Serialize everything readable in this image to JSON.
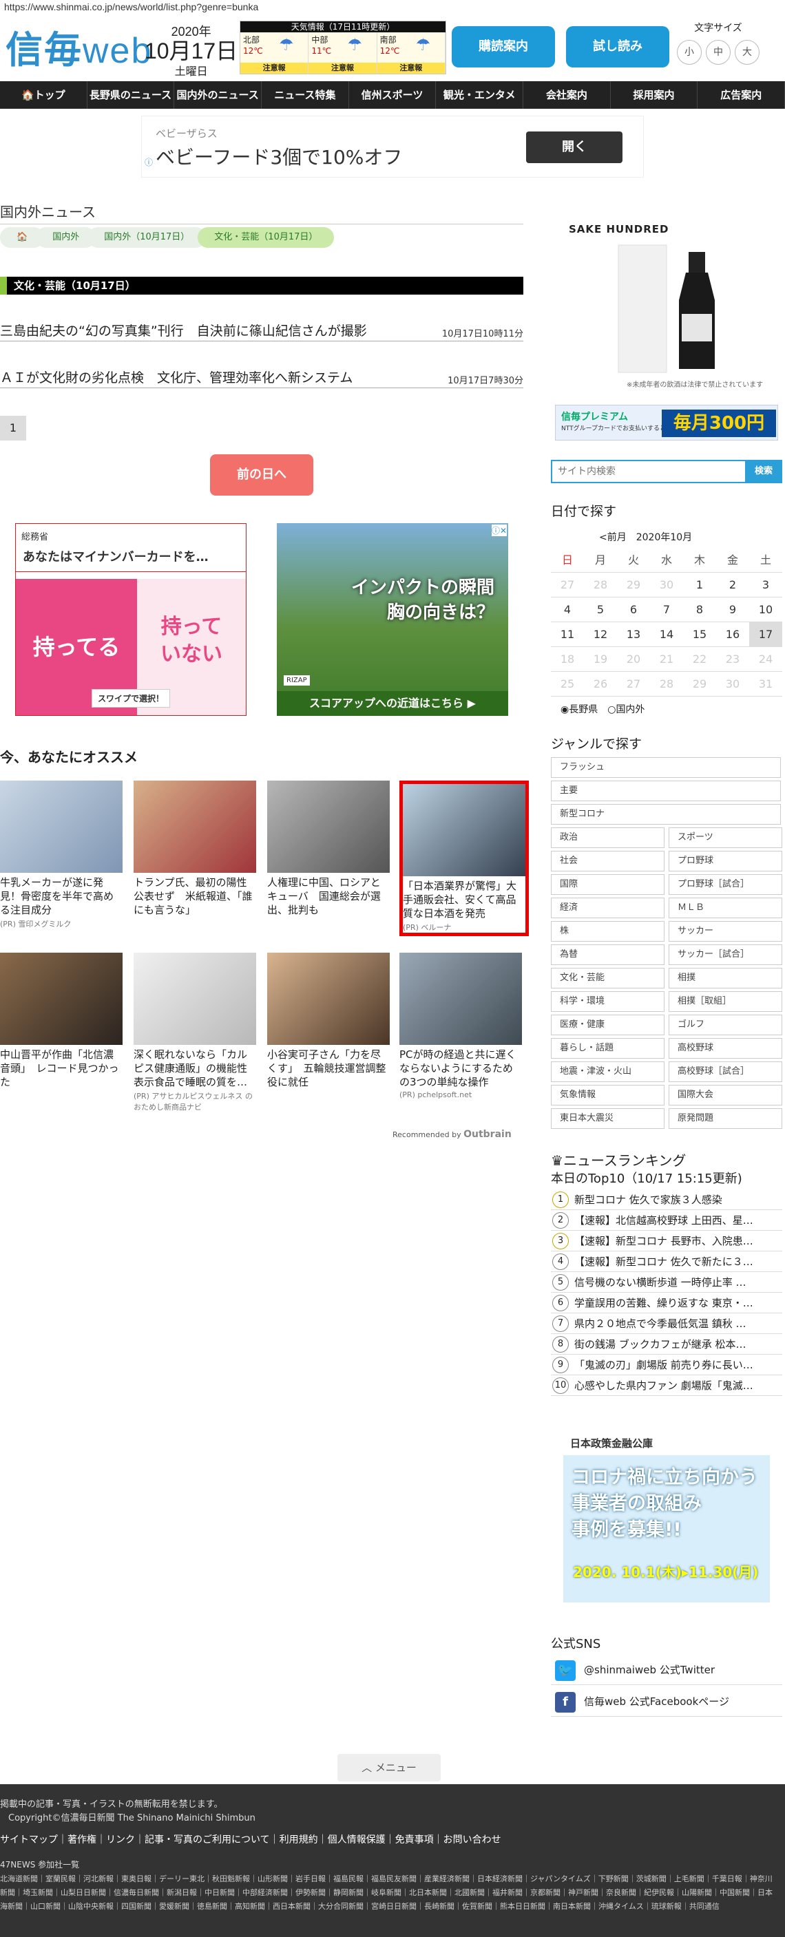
{
  "browser": {
    "url": "https://www.shinmai.co.jp/news/world/list.php?genre=bunka"
  },
  "header": {
    "logo_kanji": "信毎",
    "logo_web": "web",
    "year": "2020年",
    "month_day": "10月17日",
    "weekday": "土曜日",
    "weather_title": "天気情報（17日11時更新）",
    "regions": [
      {
        "name": "北部",
        "temp": "12℃",
        "warning": "注意報"
      },
      {
        "name": "中部",
        "temp": "11℃",
        "warning": "注意報"
      },
      {
        "name": "南部",
        "temp": "12℃",
        "warning": "注意報"
      }
    ],
    "subscribe_btn": "購読案内",
    "trial_btn": "試し読み",
    "font_size_label": "文字サイズ",
    "font_sizes": [
      "小",
      "中",
      "大"
    ]
  },
  "nav": [
    "🏠トップ",
    "長野県のニュース",
    "国内外のニュース",
    "ニュース特集",
    "信州スポーツ",
    "観光・エンタメ",
    "会社案内",
    "採用案内",
    "広告案内"
  ],
  "ad_top": {
    "sub": "ベビーザらス",
    "title": "ベビーフード3個で10%オフ",
    "button": "開く",
    "info": "ⓘ"
  },
  "section": {
    "title": "国内外ニュース",
    "breadcrumb": [
      "🏠",
      "国内外",
      "国内外（10月17日）",
      "文化・芸能（10月17日）"
    ],
    "category": "文化・芸能（10月17日）"
  },
  "articles": [
    {
      "title": "三島由紀夫の“幻の写真集”刊行　自決前に篠山紀信さんが撮影",
      "time": "10月17日10時11分"
    },
    {
      "title": "ＡＩが文化財の劣化点検　文化庁、管理効率化へ新システム",
      "time": "10月17日7時30分"
    }
  ],
  "pagination": {
    "page": "1",
    "prev_day": "前の日へ"
  },
  "ad_left": {
    "org": "総務省",
    "title": "あなたはマイナンバーカードを…",
    "left": "持ってる",
    "right": "持って\nいない",
    "swipe": "スワイプで選択！"
  },
  "ad_right": {
    "headline1": "インパクトの瞬間",
    "headline2": "胸の向きは？",
    "brand": "RIZAP",
    "footer": "スコアアップへの近道はこちら ▶"
  },
  "recommend": {
    "title": "今、あなたにオススメ",
    "cards": [
      {
        "title": "牛乳メーカーが遂に発見！骨密度を半年で高める注目成分",
        "pr": "(PR) 雪印メグミルク"
      },
      {
        "title": "トランプ氏、最初の陽性公表せず　米紙報道、「誰にも言うな」",
        "pr": ""
      },
      {
        "title": "人権理に中国、ロシアとキューバ　国連総会が選出、批判も",
        "pr": ""
      },
      {
        "title": "「日本酒業界が驚愕」大手通販会社、安くて高品質な日本酒を発売",
        "pr": "(PR) ベルーナ"
      },
      {
        "title": "中山晋平が作曲「北信濃音頭」　レコード見つかった",
        "pr": ""
      },
      {
        "title": "深く眠れないなら「カルピス健康通販」の機能性表示食品で睡眠の質を…",
        "pr": "(PR) アサヒカルピスウェルネス の おためし新商品ナビ"
      },
      {
        "title": "小谷実可子さん「力を尽くす」　五輪競技運営調整役に就任",
        "pr": ""
      },
      {
        "title": "PCが時の経過と共に遅くならないようにするための3つの単純な操作",
        "pr": "(PR) pchelpsoft.net"
      }
    ],
    "recommended_by": "Recommended by",
    "outbrain": "Outbrain"
  },
  "sidebar": {
    "sake_title": "SAKE HUNDRED",
    "sake_note": "※未成年者の飲酒は法律で禁止されています",
    "premium_a": "信毎プレミアム",
    "premium_b": "NTTグループカードでお支払いすると",
    "premium_c": "毎月300円",
    "search_placeholder": "サイト内検索",
    "search_btn": "検索",
    "date_title": "日付で探す",
    "cal_prev": "<前月",
    "cal_month": "2020年10月",
    "cal_head": [
      "日",
      "月",
      "火",
      "水",
      "木",
      "金",
      "土"
    ],
    "cal_rows": [
      [
        "27",
        "28",
        "29",
        "30",
        "1",
        "2",
        "3"
      ],
      [
        "4",
        "5",
        "6",
        "7",
        "8",
        "9",
        "10"
      ],
      [
        "11",
        "12",
        "13",
        "14",
        "15",
        "16",
        "17"
      ],
      [
        "18",
        "19",
        "20",
        "21",
        "22",
        "23",
        "24"
      ],
      [
        "25",
        "26",
        "27",
        "28",
        "29",
        "30",
        "31"
      ]
    ],
    "radio1": "長野県",
    "radio2": "国内外",
    "genre_title": "ジャンルで探す",
    "genre_full": [
      "フラッシュ",
      "主要",
      "新型コロナ"
    ],
    "genre_grid": [
      "政治",
      "スポーツ",
      "社会",
      "プロ野球",
      "国際",
      "プロ野球［試合］",
      "経済",
      "ＭＬＢ",
      "株",
      "サッカー",
      "為替",
      "サッカー［試合］",
      "文化・芸能",
      "相撲",
      "科学・環境",
      "相撲［取組］",
      "医療・健康",
      "ゴルフ",
      "暮らし・話題",
      "高校野球",
      "地震・津波・火山",
      "高校野球［試合］",
      "気象情報",
      "国際大会",
      "東日本大震災",
      "原発問題"
    ],
    "ranking_title": "ニュースランキング",
    "ranking_sub": "本日のTop10（10/17 15:15更新)",
    "ranking": [
      "新型コロナ 佐久で家族３人感染",
      "【速報】北信越高校野球 上田西、星…",
      "【速報】新型コロナ 長野市、入院患…",
      "【速報】新型コロナ 佐久で新たに３…",
      "信号機のない横断歩道 一時停止率 …",
      "学童誤用の苦難、繰り返すな 東京・…",
      "県内２０地点で今季最低気温 鎮秋 …",
      "街の銭湯 ブックカフェが継承 松本…",
      "「鬼滅の刃」劇場版 前売り券に長い…",
      "心感やした県内ファン 劇場版「鬼滅…"
    ],
    "jfc_head": "日本政策金融公庫",
    "jfc_msg1": "コロナ禍に立ち向かう",
    "jfc_msg2": "事業者の取組み",
    "jfc_msg3": "事例を募集!!",
    "jfc_date": "2020. 10.1(木)▸11.30(月)",
    "sns_title": "公式SNS",
    "twitter": "@shinmaiweb 公式Twitter",
    "facebook": "信毎web 公式Facebookページ"
  },
  "footer": {
    "menu": "メニュー",
    "copyright1": "掲載中の記事・写真・イラストの無断転用を禁じます。",
    "copyright2": "Copyright©信濃毎日新聞 The Shinano Mainichi Shimbun",
    "links": "サイトマップ｜著作権｜リンク｜記事・写真のご利用について｜利用規約｜個人情報保護｜免責事項｜お問い合わせ",
    "partners_title": "47NEWS 参加社一覧",
    "partners": "北海道新聞｜室蘭民報｜河北新報｜東奥日報｜デーリー東北｜秋田魁新報｜山形新聞｜岩手日報｜福島民報｜福島民友新聞｜産業経済新聞｜日本経済新聞｜ジャパンタイムズ｜下野新聞｜茨城新聞｜上毛新聞｜千葉日報｜神奈川新聞｜埼玉新聞｜山梨日日新聞｜信濃毎日新聞｜新潟日報｜中日新聞｜中部経済新聞｜伊勢新聞｜静岡新聞｜岐阜新聞｜北日本新聞｜北國新聞｜福井新聞｜京都新聞｜神戸新聞｜奈良新聞｜紀伊民報｜山陽新聞｜中国新聞｜日本海新聞｜山口新聞｜山陰中央新報｜四国新聞｜愛媛新聞｜徳島新聞｜高知新聞｜西日本新聞｜大分合同新聞｜宮崎日日新聞｜長崎新聞｜佐賀新聞｜熊本日日新聞｜南日本新聞｜沖縄タイムス｜琉球新報｜共同通信"
  }
}
